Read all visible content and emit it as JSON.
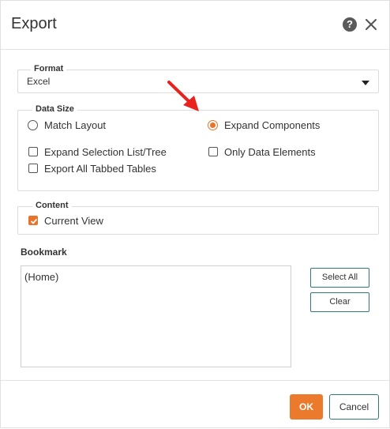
{
  "dialog": {
    "title": "Export",
    "help_icon": "question-circle-icon",
    "close_icon": "close-icon"
  },
  "format": {
    "legend": "Format",
    "selected": "Excel"
  },
  "data_size": {
    "legend": "Data Size",
    "options": [
      {
        "label": "Match Layout",
        "type": "radio",
        "checked": false
      },
      {
        "label": "Expand Components",
        "type": "radio",
        "checked": true
      },
      {
        "label": "Expand Selection List/Tree",
        "type": "checkbox",
        "checked": false
      },
      {
        "label": "Only Data Elements",
        "type": "checkbox",
        "checked": false
      },
      {
        "label": "Export All Tabbed Tables",
        "type": "checkbox",
        "checked": false
      }
    ]
  },
  "content": {
    "legend": "Content",
    "options": [
      {
        "label": "Current View",
        "type": "checkbox",
        "checked": true
      }
    ]
  },
  "bookmark": {
    "label": "Bookmark",
    "items": [
      "(Home)"
    ],
    "select_all_label": "Select All",
    "clear_label": "Clear"
  },
  "footer": {
    "ok_label": "OK",
    "cancel_label": "Cancel"
  },
  "colors": {
    "accent": "#ec7a2d",
    "button_border": "#2e7a7a",
    "annotation_arrow": "#e8231e"
  }
}
